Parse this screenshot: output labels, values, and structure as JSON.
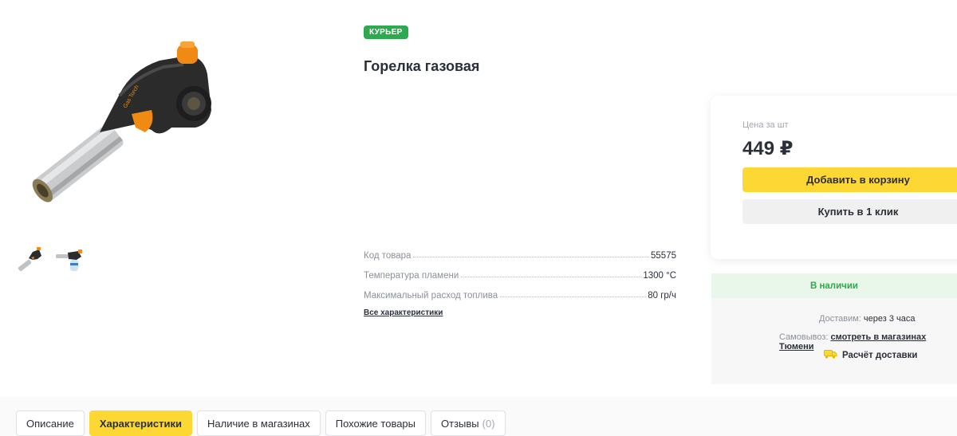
{
  "product": {
    "badge": "КУРЬЕР",
    "title": "Горелка газовая"
  },
  "gallery": {
    "main_image": "gas-torch-image",
    "thumbnails": [
      "gas-torch-thumb-1",
      "gas-torch-thumb-2"
    ]
  },
  "specs": {
    "rows": [
      {
        "name": "Код товара",
        "value": "55575"
      },
      {
        "name": "Температура пламени",
        "value": "1300 °С"
      },
      {
        "name": "Максимальный расход топлива",
        "value": "80 гр/ч"
      }
    ],
    "all_link": "Все характеристики"
  },
  "price_card": {
    "label": "Цена за шт",
    "price": "449 ₽",
    "add_to_cart": "Добавить в корзину",
    "buy_one_click": "Купить в 1 клик"
  },
  "availability": {
    "status": "В наличии",
    "delivery_label": "Доставим:",
    "delivery_value": "через 3 часа",
    "pickup_label": "Самовывоз:",
    "pickup_link": "смотреть в магазинах Тюмени",
    "calc_delivery": "Расчёт доставки"
  },
  "tabs": [
    {
      "label": "Описание",
      "active": false,
      "count": ""
    },
    {
      "label": "Характеристики",
      "active": true,
      "count": ""
    },
    {
      "label": "Наличие в магазинах",
      "active": false,
      "count": ""
    },
    {
      "label": "Похожие товары",
      "active": false,
      "count": ""
    },
    {
      "label": "Отзывы",
      "active": false,
      "count": "(0)"
    }
  ],
  "colors": {
    "accent_yellow": "#fdd835",
    "badge_green": "#2fa84f",
    "text_dark": "#2a2f3a"
  }
}
